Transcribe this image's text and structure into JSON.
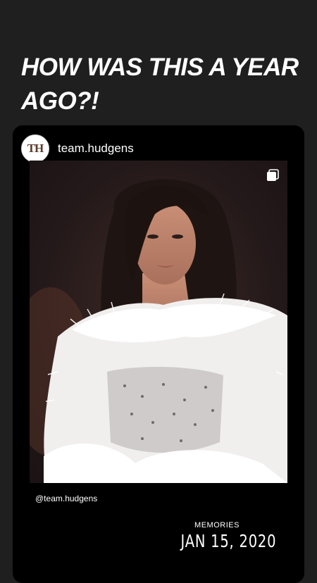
{
  "story": {
    "headline": "HOW WAS THIS A YEAR AGO?!"
  },
  "post": {
    "username": "team.hudgens",
    "avatar_initials": "TH",
    "credit": "@team.hudgens",
    "multi_icon": "multiple-photos-icon"
  },
  "memories": {
    "label": "MEMORIES",
    "date": "JAN 15, 2020"
  }
}
